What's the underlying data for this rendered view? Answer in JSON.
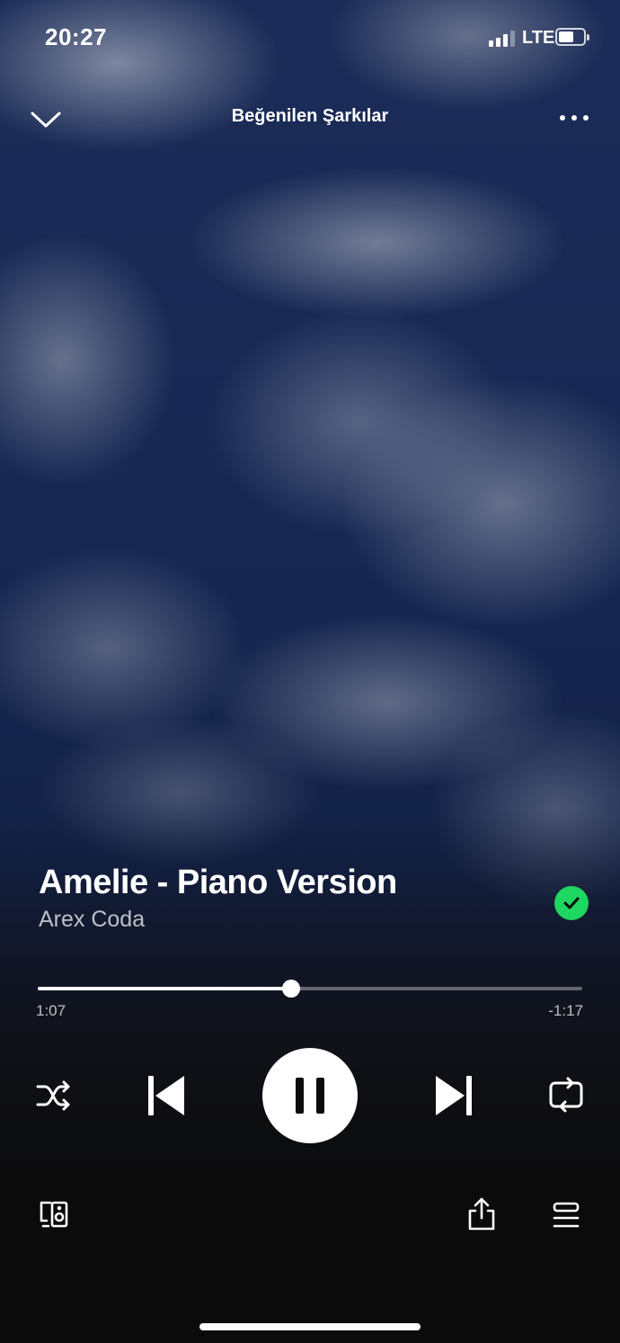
{
  "status_bar": {
    "time": "20:27",
    "network": "LTE",
    "signal_bars": 3,
    "battery_level": 0.6
  },
  "header": {
    "title": "Beğenilen Şarkılar",
    "collapse_icon": "chevron-down-icon",
    "more_icon": "more-horizontal-icon"
  },
  "track": {
    "title": "Amelie - Piano Version",
    "artist": "Arex Coda",
    "liked": true
  },
  "progress": {
    "elapsed": "1:07",
    "remaining": "-1:17",
    "fraction": 0.465
  },
  "controls": {
    "shuffle_icon": "shuffle-icon",
    "previous_icon": "skip-previous-icon",
    "play_pause_icon": "pause-icon",
    "next_icon": "skip-next-icon",
    "repeat_icon": "repeat-icon"
  },
  "bottom_bar": {
    "devices_icon": "devices-icon",
    "share_icon": "share-icon",
    "queue_icon": "queue-icon"
  },
  "colors": {
    "accent": "#1ed760",
    "sky": "#172752"
  }
}
